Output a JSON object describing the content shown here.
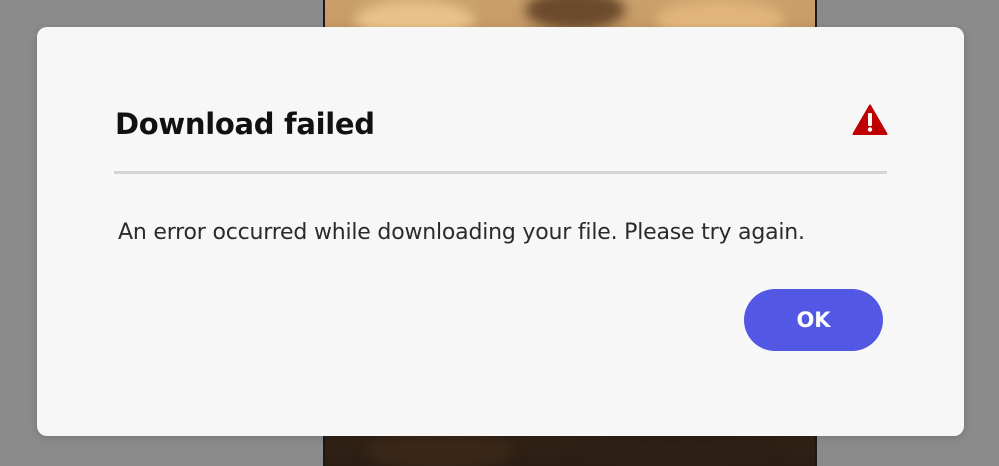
{
  "dialog": {
    "title": "Download failed",
    "icon": "alert-triangle-icon",
    "message": "An error occurred while downloading your file. Please try again.",
    "ok_label": "OK"
  },
  "colors": {
    "accent": "#5258e4",
    "alert": "#c00000",
    "dialog_background": "#f7f7f7"
  }
}
